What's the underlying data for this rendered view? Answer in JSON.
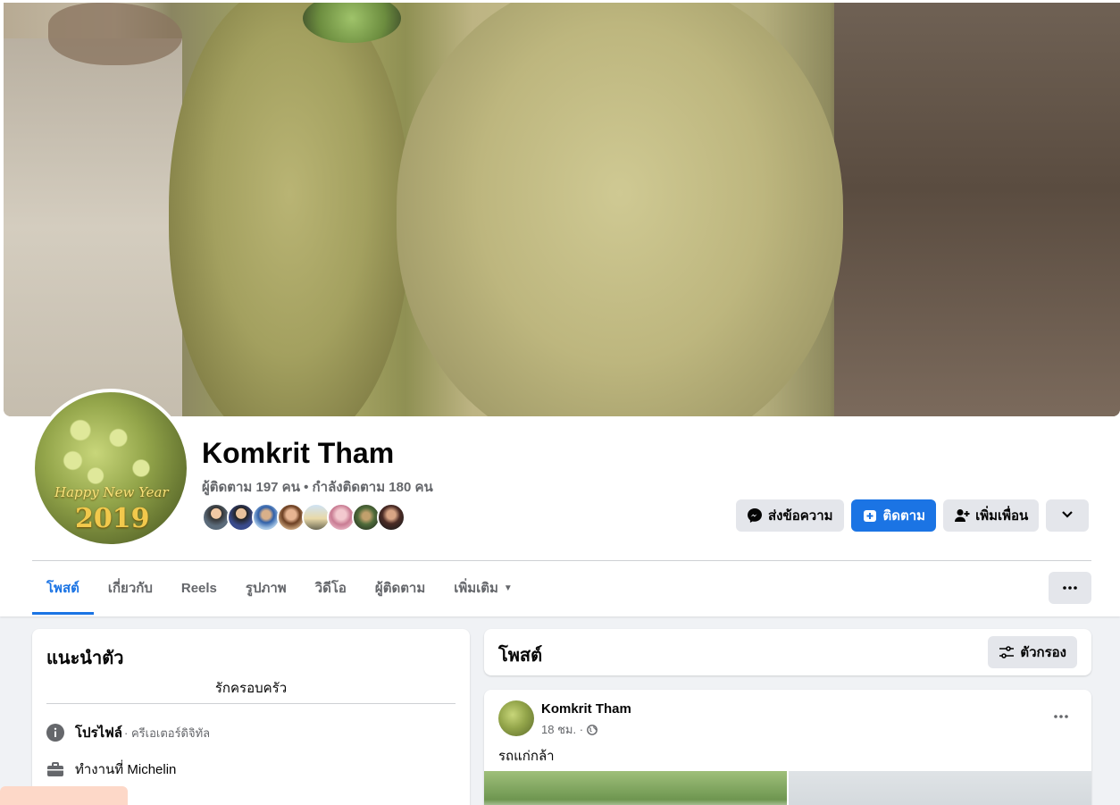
{
  "profile": {
    "name": "Komkrit Tham",
    "stats": "ผู้ติดตาม 197 คน • กำลังติดตาม 180 คน",
    "avatar_text_line1": "Happy New Year",
    "avatar_text_line2": "2019"
  },
  "actions": {
    "message": "ส่งข้อความ",
    "follow": "ติดตาม",
    "add_friend": "เพิ่มเพื่อน"
  },
  "tabs": [
    {
      "label": "โพสต์"
    },
    {
      "label": "เกี่ยวกับ"
    },
    {
      "label": "Reels"
    },
    {
      "label": "รูปภาพ"
    },
    {
      "label": "วิดีโอ"
    },
    {
      "label": "ผู้ติดตาม"
    },
    {
      "label": "เพิ่มเติม"
    }
  ],
  "intro": {
    "title": "แนะนำตัว",
    "bio": "รักครอบครัว",
    "profile_label": "โปรไฟล์",
    "profile_value": " · ครีเอเตอร์ดิจิทัล",
    "work": "ทำงานที่ Michelin"
  },
  "posts": {
    "title": "โพสต์",
    "filter": "ตัวกรอง"
  },
  "post": {
    "author": "Komkrit Tham",
    "time": "18 ชม. ·",
    "text": "รถแก่กล้า"
  },
  "colors": {
    "accent": "#1b74e4",
    "button_gray": "#e4e6eb",
    "muted_text": "#65676b"
  }
}
